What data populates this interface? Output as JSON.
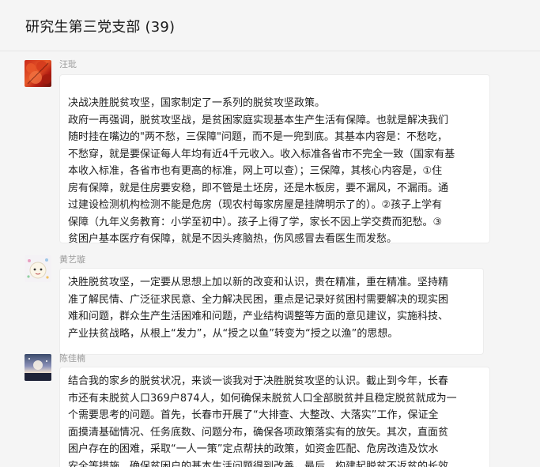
{
  "header": {
    "title": "研究生第三党支部 (39)"
  },
  "messages": [
    {
      "sender": "汪玭",
      "avatar_icon": "red-leaves-avatar",
      "lines": [
        "决战决胜脱贫攻坚，国家制定了一系列的脱贫攻坚政策。",
        "政府一再强调，脱贫攻坚战，是贫困家庭实现基本生产生活有保障。也就是解决我们",
        "随时挂在嘴边的\"两不愁，三保障\"问题，而不是一兜到底。其基本内容是：不愁吃，",
        "不愁穿，就是要保证每人年均有近4千元收入。收入标准各省市不完全一致（国家有基",
        "本收入标准，各省市也有更高的标准，网上可以查）；三保障，其核心内容是，①住",
        "房有保障，就是住房要安稳，即不管是土坯房，还是木板房，要不漏风，不漏雨。通",
        "过建设检测机构检测不能是危房（现农村每家房屋是挂牌明示了的）。②孩子上学有",
        "保障（九年义务教育：小学至初中）。孩子上得了学，家长不因上学交费而犯愁。③",
        "贫困户基本医疗有保障，就是不因头疼脑热，伤风感冒去看医生而发愁。"
      ]
    },
    {
      "sender": "黄艺璇",
      "avatar_icon": "cartoon-avatar",
      "lines": [
        "决胜脱贫攻坚，一定要从思想上加以新的改变和认识，贵在精准，重在精准。坚持精",
        "准了解民情、广泛征求民意、全力解决民困，重点是记录好贫困村需要解决的现实困",
        "难和问题，群众生产生活困难和问题，产业结构调整等方面的意见建议，实施科技、",
        "产业扶贫战略，从根上“发力”，从“授之以鱼”转变为“授之以渔”的思想。"
      ]
    },
    {
      "sender": "陈佳楠",
      "avatar_icon": "night-sky-avatar",
      "lines": [
        "结合我的家乡的脱贫状况，来谈一谈我对于决胜脱贫攻坚的认识。截止到今年，长春",
        "市还有未脱贫人口369户874人，如何确保未脱贫人口全部脱贫并且稳定脱贫就成为一",
        "个需要思考的问题。首先，长春市开展了“大排查、大整改、大落实”工作，保证全",
        "面摸清基础情况、任务底数、问题分布，确保各项政策落实有的放矢。其次，直面贫",
        "困户存在的困难，采取“一人一策”定点帮扶的政策，如资金匹配、危房改造及饮水",
        "安全等措施，确保贫困户的基本生活问题得到改善。最后，构建起脱贫不返贫的长效"
      ]
    }
  ]
}
